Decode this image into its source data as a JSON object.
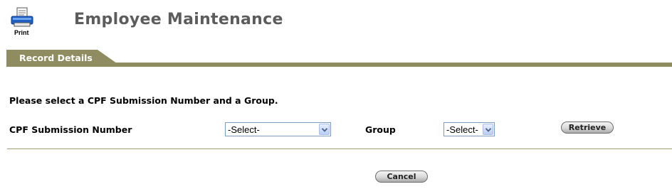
{
  "toolbar": {
    "print_label": "Print"
  },
  "page": {
    "title": "Employee Maintenance"
  },
  "tabs": [
    {
      "label": "Record Details"
    }
  ],
  "form": {
    "instruction": "Please select a CPF Submission Number and a Group.",
    "cpf_submission": {
      "label": "CPF Submission Number",
      "selected": "-Select-"
    },
    "group": {
      "label": "Group",
      "selected": "-Select-"
    },
    "retrieve_label": "Retrieve",
    "cancel_label": "Cancel"
  },
  "colors": {
    "tab_bar": "#8e8c60",
    "title_text": "#5c5c5c",
    "select_border": "#7f9db9"
  },
  "icons": {
    "print": "printer-icon",
    "dropdown": "chevron-down-icon"
  }
}
